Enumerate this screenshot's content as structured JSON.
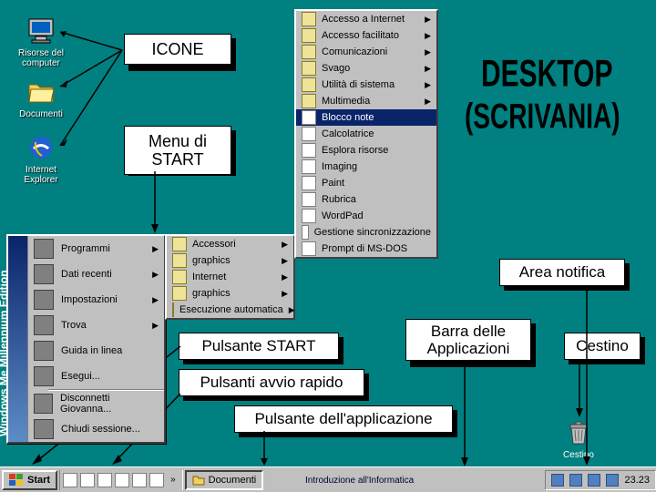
{
  "desktop_icons": {
    "risorse": "Risorse del computer",
    "documenti": "Documenti",
    "ie": "Internet Explorer"
  },
  "callouts": {
    "icone": "ICONE",
    "menu_start": "Menu di START",
    "pulsante_start": "Pulsante START",
    "pulsanti_avvio": "Pulsanti avvio rapido",
    "pulsante_app": "Pulsante dell'applicazione",
    "barra_app": "Barra delle Applicazioni",
    "area_notifica": "Area notifica",
    "cestino": "Cestino"
  },
  "wordart": {
    "l1": "DESKTOP",
    "l2": "(SCRIVANIA)"
  },
  "start_menu": {
    "strip": "Windows Me Millennium Edition",
    "items": [
      {
        "label": "Programmi",
        "arrow": true
      },
      {
        "label": "Dati recenti",
        "arrow": true
      },
      {
        "label": "Impostazioni",
        "arrow": true
      },
      {
        "label": "Trova",
        "arrow": true
      },
      {
        "label": "Guida in linea",
        "arrow": false
      },
      {
        "label": "Esegui...",
        "arrow": false
      }
    ],
    "disconnect": "Disconnetti Giovanna...",
    "shutdown": "Chiudi sessione..."
  },
  "submenu1": [
    "Accessori",
    "graphics",
    "Internet",
    "graphics",
    "Esecuzione automatica"
  ],
  "submenu2_top": [
    "Accesso a Internet",
    "Accesso facilitato",
    "Comunicazioni",
    "Svago",
    "Utilità di sistema",
    "Multimedia"
  ],
  "submenu2_sel": "Blocco note",
  "submenu2_rest": [
    "Calcolatrice",
    "Esplora risorse",
    "Imaging",
    "Paint",
    "Rubrica",
    "WordPad",
    "Gestione sincronizzazione",
    "Prompt di MS-DOS"
  ],
  "taskbar": {
    "start": "Start",
    "task_doc": "Documenti",
    "clock": "23.23",
    "chev": "»"
  },
  "cestino_label": "Cestino",
  "footnote": "Introduzione all'Informatica"
}
